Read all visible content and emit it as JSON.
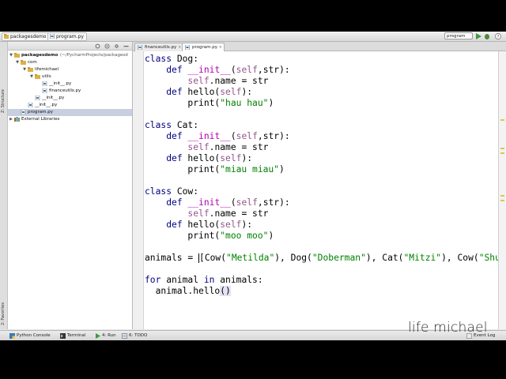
{
  "navbar": {
    "breadcrumbs": [
      "packagesdemo",
      "program.py"
    ],
    "run_config": "program"
  },
  "side_strip": {
    "structure_label": "Z: Structure",
    "favorites_label": "2: Favorites"
  },
  "project_tree": [
    {
      "label": "packagesdemo",
      "path": "(~/PycharmProjects/packagesd",
      "indent": 0,
      "expanded": true,
      "type": "folder"
    },
    {
      "label": "com",
      "indent": 1,
      "expanded": true,
      "type": "folder"
    },
    {
      "label": "lifemichael",
      "indent": 2,
      "expanded": true,
      "type": "folder"
    },
    {
      "label": "utils",
      "indent": 3,
      "expanded": true,
      "type": "folder"
    },
    {
      "label": "__init__.py",
      "indent": 4,
      "type": "py"
    },
    {
      "label": "financeutils.py",
      "indent": 4,
      "type": "py"
    },
    {
      "label": "__init__.py",
      "indent": 3,
      "type": "py"
    },
    {
      "label": "__init__.py",
      "indent": 2,
      "type": "py"
    },
    {
      "label": "program.py",
      "indent": 1,
      "type": "py",
      "selected": true
    },
    {
      "label": "External Libraries",
      "indent": 0,
      "expanded": false,
      "type": "lib"
    }
  ],
  "editor_tabs": [
    {
      "label": "financeutils.py",
      "active": false
    },
    {
      "label": "program.py",
      "active": true
    }
  ],
  "code_lines": [
    "class Dog:",
    "    def __init__(self,str):",
    "        self.name = str",
    "    def hello(self):",
    "        print(\"hau hau\")",
    "",
    "class Cat:",
    "    def __init__(self,str):",
    "        self.name = str",
    "    def hello(self):",
    "        print(\"miau miau\")",
    "",
    "class Cow:",
    "    def __init__(self,str):",
    "        self.name = str",
    "    def hello(self):",
    "        print(\"moo moo\")",
    "",
    "animals = [Cow(\"Metilda\"), Dog(\"Doberman\"), Cat(\"Mitzi\"), Cow(\"Shu",
    "",
    "for animal in animals:",
    "  animal.hello()"
  ],
  "bottom_tools": [
    {
      "label": "Python Console",
      "icon": "python-console-icon"
    },
    {
      "label": "Terminal",
      "icon": "terminal-icon"
    },
    {
      "label": "4: Run",
      "icon": "run-icon"
    },
    {
      "label": "6: TODO",
      "icon": "todo-icon"
    }
  ],
  "event_log": "Event Log",
  "watermark": "life michael",
  "colors": {
    "keyword": "#000080",
    "string": "#008000",
    "self": "#94558d",
    "magic": "#b200b2",
    "selection": "#c7cfe0"
  }
}
